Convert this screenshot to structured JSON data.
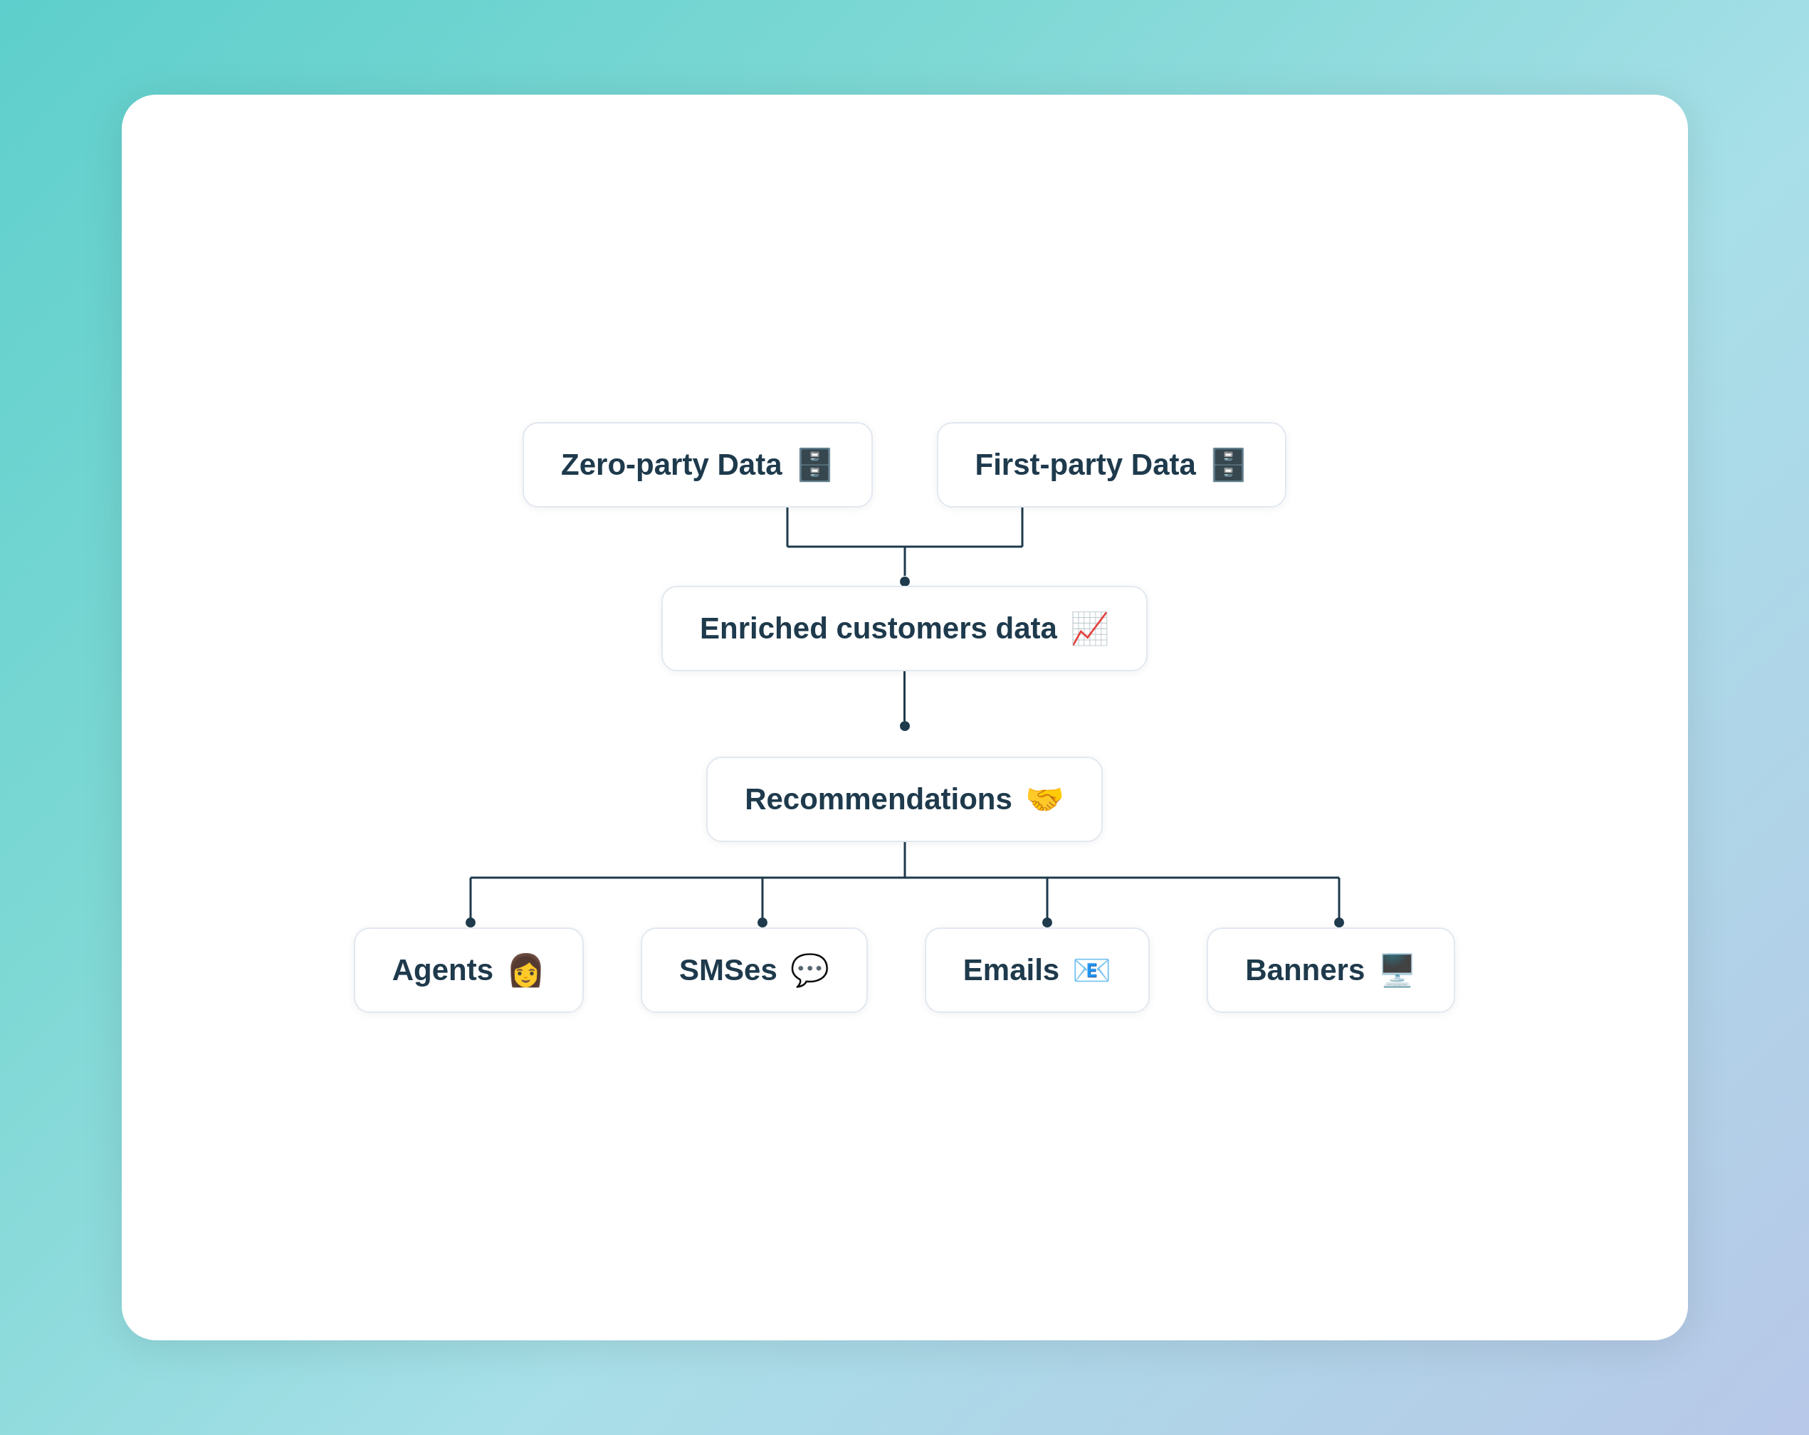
{
  "background": {
    "gradient_start": "#5ecfcc",
    "gradient_end": "#b8c8e8"
  },
  "card": {
    "background": "#ffffff"
  },
  "nodes": {
    "zero_party": {
      "label": "Zero-party Data",
      "icon": "🗄️"
    },
    "first_party": {
      "label": "First-party Data",
      "icon": "🗄️"
    },
    "enriched": {
      "label": "Enriched customers data",
      "icon": "📈"
    },
    "recommendations": {
      "label": "Recommendations",
      "icon": "🤝"
    },
    "agents": {
      "label": "Agents",
      "icon": "👩"
    },
    "smses": {
      "label": "SMSes",
      "icon": "💬"
    },
    "emails": {
      "label": "Emails",
      "icon": "📧"
    },
    "banners": {
      "label": "Banners",
      "icon": "🖥️"
    }
  }
}
